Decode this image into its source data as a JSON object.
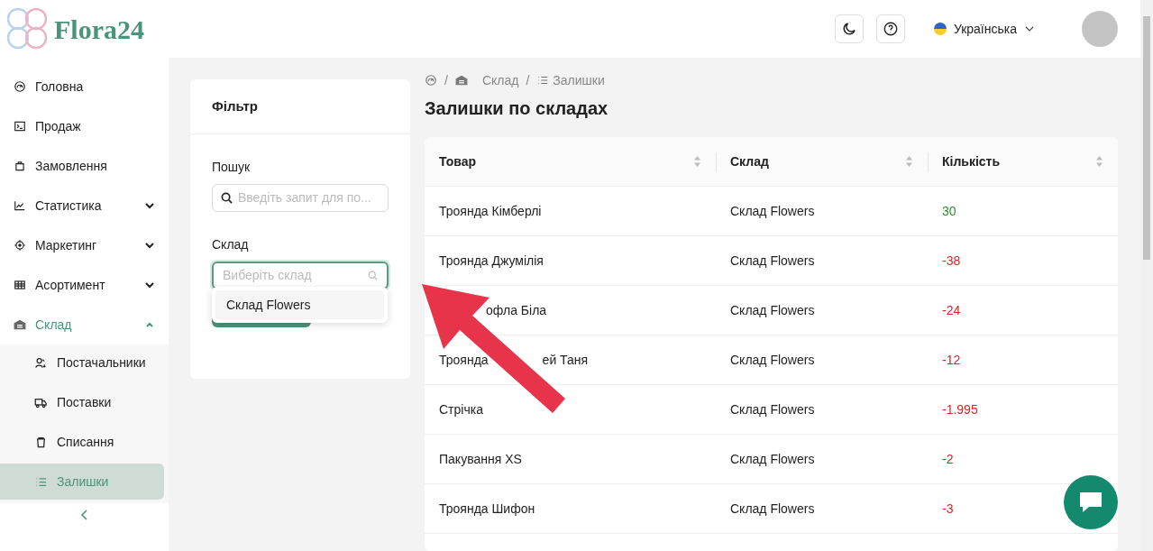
{
  "brand": "Flora24",
  "header": {
    "language": "Українська"
  },
  "sidebar": {
    "items": [
      {
        "label": "Головна",
        "selected": false
      },
      {
        "label": "Продаж",
        "selected": false
      },
      {
        "label": "Замовлення",
        "selected": false
      },
      {
        "label": "Статистика",
        "expanded": false,
        "selected": false
      },
      {
        "label": "Маркетинг",
        "expanded": false,
        "selected": false
      },
      {
        "label": "Асортимент",
        "expanded": false,
        "selected": false
      },
      {
        "label": "Склад",
        "expanded": true,
        "selected": true,
        "children": [
          {
            "label": "Постачальники",
            "selected": false
          },
          {
            "label": "Поставки",
            "selected": false
          },
          {
            "label": "Списання",
            "selected": false
          },
          {
            "label": "Залишки",
            "selected": true
          }
        ]
      }
    ]
  },
  "filter": {
    "title": "Фільтр",
    "search_label": "Пошук",
    "search_placeholder": "Введіть запит для по...",
    "warehouse_label": "Склад",
    "warehouse_placeholder": "Виберіть склад",
    "options": [
      "Склад Flowers"
    ]
  },
  "breadcrumb": [
    {
      "kind": "home"
    },
    {
      "kind": "separator",
      "text": "/"
    },
    {
      "kind": "link",
      "text": "Склад"
    },
    {
      "kind": "separator",
      "text": "/"
    },
    {
      "kind": "link",
      "text": "Залишки"
    }
  ],
  "title": "Залишки по складах",
  "table": {
    "columns": [
      "Товар",
      "Склад",
      "Кількість"
    ],
    "rows": [
      {
        "product": [
          "Троянда Кімберлі"
        ],
        "warehouse": "Склад Flowers",
        "quantity": "30",
        "positive": true
      },
      {
        "product": [
          "Троянда Джумілія"
        ],
        "warehouse": "Склад Flowers",
        "quantity": "-38",
        "positive": false
      },
      {
        "product": [
          "офла Біла"
        ],
        "covered": true,
        "warehouse": "Склад Flowers",
        "quantity": "-24",
        "positive": false
      },
      {
        "product": [
          "Троянда",
          "ей Таня"
        ],
        "covered": true,
        "warehouse": "Склад Flowers",
        "quantity": "-12",
        "positive": false
      },
      {
        "product": [
          "Стрічка"
        ],
        "warehouse": "Склад Flowers",
        "quantity": "-1.995",
        "positive": false
      },
      {
        "product": [
          "Пакування XS"
        ],
        "warehouse": "Склад Flowers",
        "quantity": "-2",
        "positive": false
      },
      {
        "product": [
          "Троянда Шифон"
        ],
        "warehouse": "Склад Flowers",
        "quantity": "-3",
        "positive": false
      }
    ]
  }
}
